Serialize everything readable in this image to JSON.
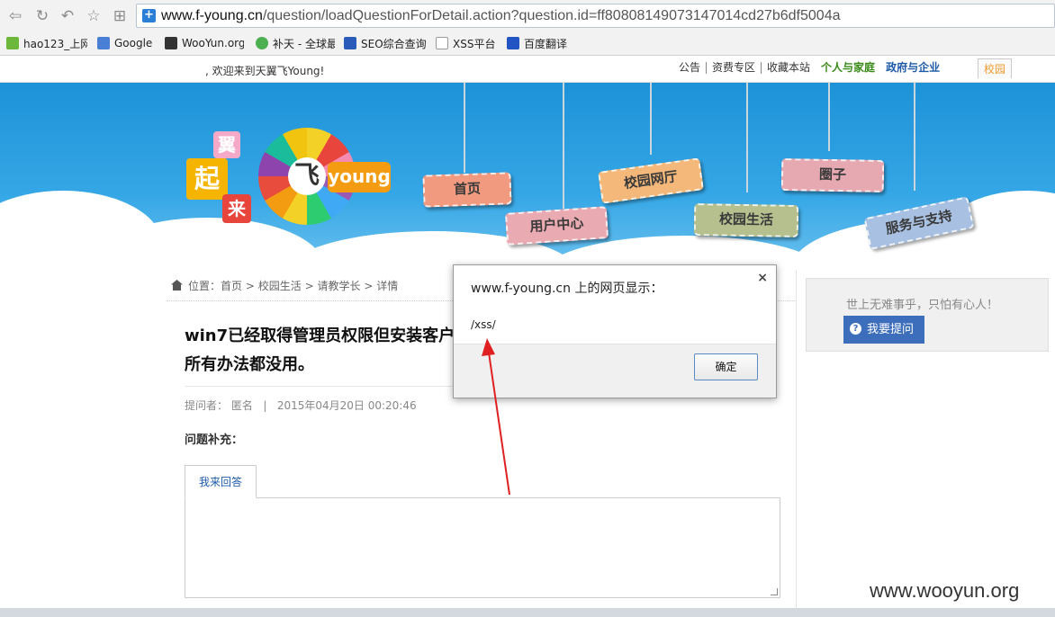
{
  "browser": {
    "url_host": "www.f-young.cn",
    "url_path": "/question/loadQuestionForDetail.action?question.id=ff80808149073147014cd27b6df5004a",
    "bookmarks": [
      {
        "label": "hao123_上网",
        "icon": "hao123-icon"
      },
      {
        "label": "Google",
        "icon": "google-icon"
      },
      {
        "label": "WooYun.org",
        "icon": "wooyun-icon"
      },
      {
        "label": "补天 - 全球最",
        "icon": "butian-icon"
      },
      {
        "label": "SEO综合查询",
        "icon": "seo-icon"
      },
      {
        "label": "XSS平台",
        "icon": "page-icon"
      },
      {
        "label": "百度翻译",
        "icon": "baidu-icon"
      }
    ]
  },
  "site_topbar": {
    "welcome": ", 欢迎来到天翼飞Young!",
    "links": [
      "公告",
      "资费专区",
      "收藏本站"
    ],
    "link_personal": "个人与家庭",
    "link_business": "政府与企业",
    "tab_campus": "校园"
  },
  "banner": {
    "signs": [
      "首页",
      "用户中心",
      "校园网厅",
      "校园生活",
      "圈子",
      "服务与支持"
    ],
    "logo_text": "young",
    "logo_center": "飞",
    "logo_chars": [
      "翼",
      "起",
      "来"
    ]
  },
  "breadcrumb": {
    "prefix": "位置：",
    "items": [
      "首页",
      "校园生活",
      "请教学长",
      "详情"
    ],
    "sep": ">"
  },
  "question": {
    "title_line1": "win7已经取得管理员权限但安装客户端",
    "title_line2": "所有办法都没用。",
    "asker_label": "提问者：",
    "asker": "匿名",
    "meta_sep": "|",
    "time": "2015年04月20日 00:20:46",
    "supplement_label": "问题补充："
  },
  "answer": {
    "tab_label": "我来回答"
  },
  "sidebar": {
    "slogan": "世上无难事乎，只怕有心人！",
    "ask_button": "我要提问"
  },
  "dialog": {
    "title": "www.f-young.cn 上的网页显示：",
    "message": "/xss/",
    "close": "×",
    "ok": "确定"
  },
  "watermark": "www.wooyun.org",
  "colors": {
    "banner_blue": "#2c9fe0",
    "ask_button": "#3d6ebc",
    "arrow_red": "#e02020",
    "link_green": "#3a8a1a",
    "link_blue": "#1e5aa8"
  }
}
